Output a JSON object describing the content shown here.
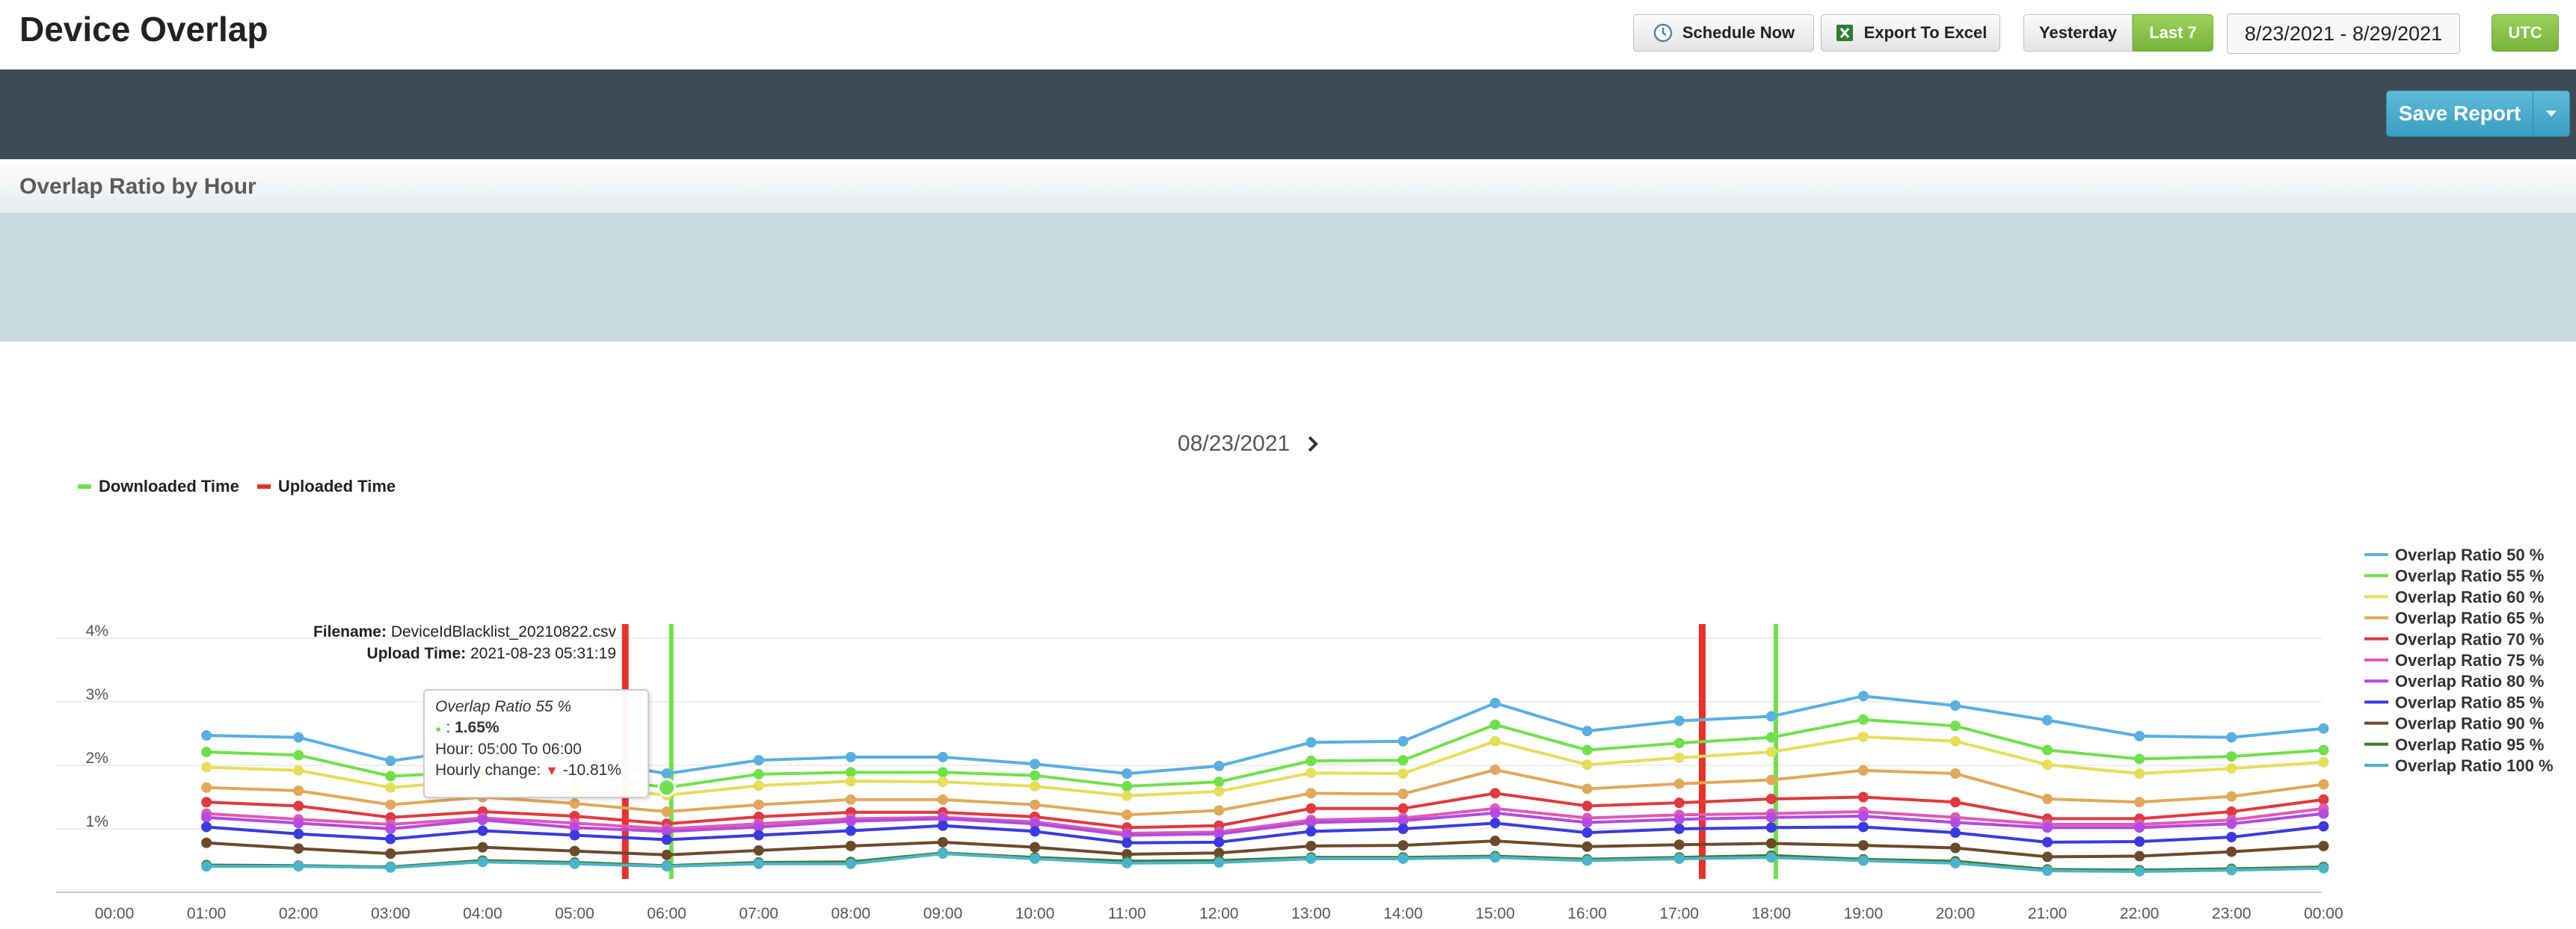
{
  "header": {
    "title": "Device Overlap",
    "schedule_label": "Schedule Now",
    "export_label": "Export To Excel",
    "range_options": [
      "Yesterday",
      "Last 7"
    ],
    "selected_range": "Last 7",
    "date_range": "8/23/2021 - 8/29/2021",
    "timezone_label": "UTC"
  },
  "toolbar": {
    "save_label": "Save Report"
  },
  "section": {
    "title": "Overlap Ratio by Hour"
  },
  "chart_nav": {
    "date": "08/23/2021"
  },
  "event_legend": [
    {
      "label": "Downloaded Time",
      "color": "#6fe04b"
    },
    {
      "label": "Uploaded Time",
      "color": "#e8312a"
    }
  ],
  "file_info": {
    "filename_label": "Filename:",
    "filename": "DeviceIdBlacklist_20210822.csv",
    "upload_label": "Upload Time:",
    "upload_time": "2021-08-23 05:31:19"
  },
  "tooltip": {
    "title": "Overlap Ratio 55 %",
    "point_prefix": ":",
    "point_value": "1.65%",
    "hour": "Hour: 05:00 To 06:00",
    "change_label": "Hourly change:",
    "change_value": "-10.81%"
  },
  "chart_data": {
    "type": "line",
    "x": [
      "00:00",
      "01:00",
      "02:00",
      "03:00",
      "04:00",
      "05:00",
      "06:00",
      "07:00",
      "08:00",
      "09:00",
      "10:00",
      "11:00",
      "12:00",
      "13:00",
      "14:00",
      "15:00",
      "16:00",
      "17:00",
      "18:00",
      "19:00",
      "20:00",
      "21:00",
      "22:00",
      "23:00",
      "00:00"
    ],
    "y_ticks": [
      "1%",
      "2%",
      "3%",
      "4%"
    ],
    "ylim": [
      0,
      4
    ],
    "grid": true,
    "legend_placement": "right",
    "series": [
      {
        "name": "Overlap Ratio 50 %",
        "color": "#5aaee0",
        "values": [
          null,
          2.47,
          2.44,
          2.07,
          2.27,
          2.1,
          1.87,
          2.08,
          2.13,
          2.13,
          2.02,
          1.87,
          1.99,
          2.36,
          2.38,
          2.98,
          2.54,
          2.7,
          2.77,
          3.09,
          2.94,
          2.71,
          2.46,
          2.44,
          2.58
        ]
      },
      {
        "name": "Overlap Ratio 55 %",
        "color": "#6fe04b",
        "values": [
          null,
          2.21,
          2.16,
          1.83,
          1.9,
          1.85,
          1.65,
          1.86,
          1.89,
          1.89,
          1.84,
          1.67,
          1.74,
          2.07,
          2.08,
          2.64,
          2.24,
          2.35,
          2.44,
          2.72,
          2.62,
          2.24,
          2.1,
          2.14,
          2.24
        ]
      },
      {
        "name": "Overlap Ratio 60 %",
        "color": "#e6de5a",
        "values": [
          null,
          1.97,
          1.92,
          1.65,
          1.77,
          1.68,
          1.53,
          1.68,
          1.75,
          1.74,
          1.67,
          1.52,
          1.59,
          1.88,
          1.87,
          2.38,
          2.01,
          2.12,
          2.21,
          2.45,
          2.38,
          2.01,
          1.87,
          1.95,
          2.05
        ]
      },
      {
        "name": "Overlap Ratio 65 %",
        "color": "#e0a85a",
        "values": [
          null,
          1.65,
          1.6,
          1.38,
          1.5,
          1.4,
          1.27,
          1.38,
          1.46,
          1.46,
          1.38,
          1.22,
          1.29,
          1.56,
          1.55,
          1.93,
          1.63,
          1.71,
          1.77,
          1.92,
          1.87,
          1.47,
          1.42,
          1.51,
          1.7
        ]
      },
      {
        "name": "Overlap Ratio 70 %",
        "color": "#e0393f",
        "values": [
          null,
          1.42,
          1.36,
          1.18,
          1.27,
          1.2,
          1.08,
          1.19,
          1.26,
          1.26,
          1.19,
          1.02,
          1.05,
          1.32,
          1.32,
          1.56,
          1.36,
          1.41,
          1.47,
          1.5,
          1.42,
          1.16,
          1.16,
          1.27,
          1.46
        ]
      },
      {
        "name": "Overlap Ratio 75 %",
        "color": "#e05ab4",
        "values": [
          null,
          1.24,
          1.15,
          1.07,
          1.17,
          1.09,
          1.0,
          1.08,
          1.16,
          1.18,
          1.11,
          0.93,
          0.95,
          1.14,
          1.17,
          1.32,
          1.17,
          1.22,
          1.24,
          1.27,
          1.18,
          1.07,
          1.07,
          1.14,
          1.32
        ]
      },
      {
        "name": "Overlap Ratio 80 %",
        "color": "#b44ae0",
        "values": [
          null,
          1.18,
          1.09,
          1.0,
          1.14,
          1.02,
          0.96,
          1.03,
          1.12,
          1.16,
          1.08,
          0.9,
          0.92,
          1.1,
          1.13,
          1.25,
          1.1,
          1.15,
          1.18,
          1.2,
          1.1,
          1.02,
          1.02,
          1.08,
          1.24
        ]
      },
      {
        "name": "Overlap Ratio 85 %",
        "color": "#3a3ae0",
        "values": [
          null,
          1.03,
          0.92,
          0.84,
          0.97,
          0.9,
          0.83,
          0.9,
          0.97,
          1.05,
          0.96,
          0.78,
          0.79,
          0.96,
          1.0,
          1.09,
          0.94,
          1.0,
          1.02,
          1.03,
          0.94,
          0.79,
          0.8,
          0.87,
          1.04
        ]
      },
      {
        "name": "Overlap Ratio 90 %",
        "color": "#6b4a2a",
        "values": [
          null,
          0.78,
          0.69,
          0.61,
          0.71,
          0.65,
          0.59,
          0.66,
          0.73,
          0.79,
          0.71,
          0.6,
          0.62,
          0.73,
          0.74,
          0.81,
          0.72,
          0.75,
          0.77,
          0.74,
          0.7,
          0.56,
          0.57,
          0.64,
          0.73
        ]
      },
      {
        "name": "Overlap Ratio 95 %",
        "color": "#3e7a2e",
        "values": [
          null,
          0.43,
          0.42,
          0.4,
          0.5,
          0.47,
          0.42,
          0.47,
          0.48,
          0.62,
          0.55,
          0.49,
          0.5,
          0.55,
          0.55,
          0.57,
          0.52,
          0.55,
          0.58,
          0.52,
          0.49,
          0.36,
          0.35,
          0.37,
          0.4
        ]
      },
      {
        "name": "Overlap Ratio 100 %",
        "color": "#4bb4c8",
        "values": [
          null,
          0.41,
          0.41,
          0.39,
          0.48,
          0.45,
          0.41,
          0.45,
          0.45,
          0.61,
          0.53,
          0.46,
          0.47,
          0.53,
          0.53,
          0.55,
          0.5,
          0.53,
          0.55,
          0.5,
          0.46,
          0.34,
          0.33,
          0.35,
          0.38
        ]
      }
    ],
    "events": [
      {
        "type": "Uploaded Time",
        "x": 5.55
      },
      {
        "type": "Downloaded Time",
        "x": 6.05
      },
      {
        "type": "Uploaded Time",
        "x": 17.25
      },
      {
        "type": "Downloaded Time",
        "x": 18.05
      }
    ],
    "highlight": {
      "series": 1,
      "index": 6
    }
  }
}
